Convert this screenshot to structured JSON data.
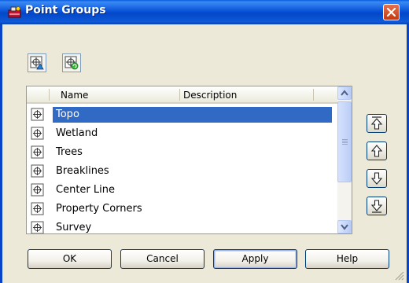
{
  "window": {
    "title": "Point Groups"
  },
  "toolbar": {
    "buttons": [
      {
        "icon": "point-group-properties-icon"
      },
      {
        "icon": "point-group-update-icon"
      }
    ]
  },
  "list": {
    "columns": [
      "Name",
      "Description"
    ],
    "selected_index": 0,
    "rows": [
      {
        "name": "Topo",
        "description": ""
      },
      {
        "name": "Wetland",
        "description": ""
      },
      {
        "name": "Trees",
        "description": ""
      },
      {
        "name": "Breaklines",
        "description": ""
      },
      {
        "name": "Center Line",
        "description": ""
      },
      {
        "name": "Property Corners",
        "description": ""
      },
      {
        "name": "Survey",
        "description": ""
      }
    ]
  },
  "order_buttons": [
    "move-to-top-icon",
    "move-up-icon",
    "move-down-icon",
    "move-to-bottom-icon"
  ],
  "buttons": {
    "ok": "OK",
    "cancel": "Cancel",
    "apply": "Apply",
    "help": "Help"
  },
  "colors": {
    "title_bar": "#0A54D8",
    "selection": "#316AC5",
    "dialog_bg": "#ECE9D8"
  }
}
